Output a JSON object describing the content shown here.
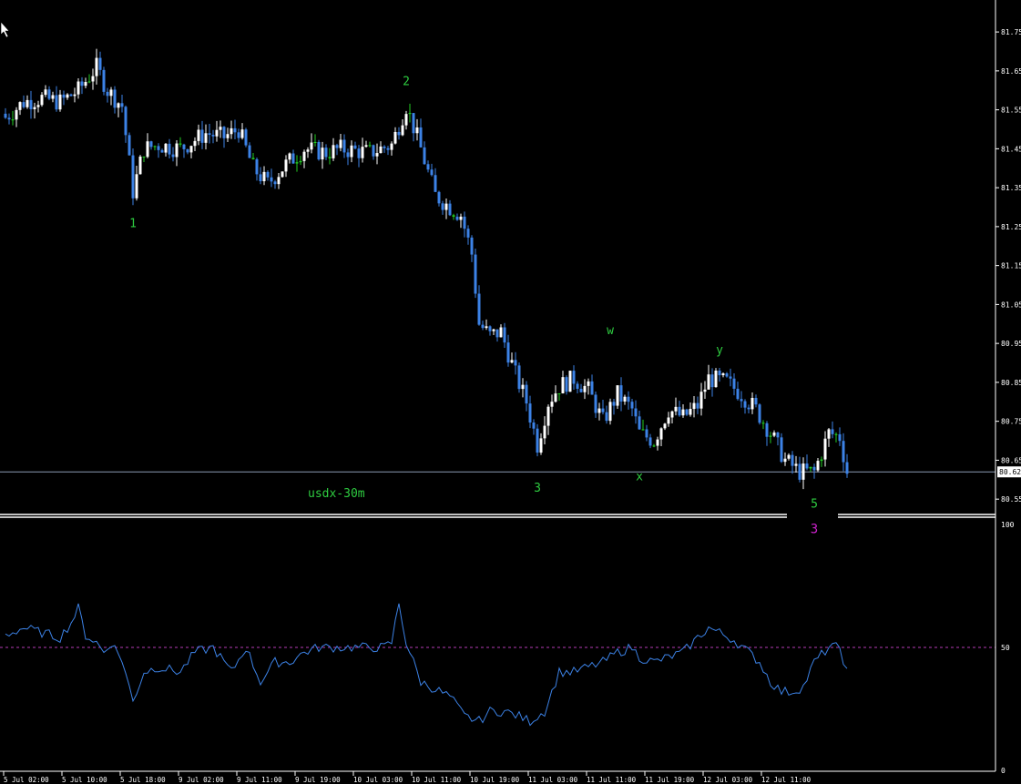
{
  "chart_data": [
    {
      "type": "candlestick",
      "title": "usdx-30m",
      "y_ticks": [
        "81.75",
        "81.65",
        "81.55",
        "81.45",
        "81.35",
        "81.25",
        "81.15",
        "81.05",
        "80.95",
        "80.85",
        "80.75",
        "80.65",
        "80.55"
      ],
      "ylim": [
        80.52,
        81.79
      ],
      "current_price": 80.62,
      "current_price_label": "80.62",
      "x_ticks": [
        "5 Jul 02:00",
        "5 Jul 10:00",
        "5 Jul 18:00",
        "9 Jul 02:00",
        "9 Jul 11:00",
        "9 Jul 19:00",
        "10 Jul 03:00",
        "10 Jul 11:00",
        "10 Jul 19:00",
        "11 Jul 03:00",
        "11 Jul 11:00",
        "11 Jul 19:00",
        "12 Jul 03:00",
        "12 Jul 11:00"
      ],
      "colors": {
        "bull": "#ffffff",
        "bear": "#3c82e6",
        "doji": "#22cc22",
        "price_line": "#8c9bb4",
        "labels": "#2ecc40",
        "magenta": "#cc22cc"
      },
      "wave_labels": [
        {
          "text": "1",
          "bar": 35,
          "price": 81.3,
          "place": "below"
        },
        {
          "text": "2",
          "bar": 110,
          "price": 81.59,
          "place": "above"
        },
        {
          "text": "3",
          "bar": 146,
          "price": 80.62,
          "place": "below"
        },
        {
          "text": "w",
          "bar": 166,
          "price": 80.95,
          "place": "above"
        },
        {
          "text": "x",
          "bar": 174,
          "price": 80.65,
          "place": "below"
        },
        {
          "text": "y",
          "bar": 196,
          "price": 80.9,
          "place": "above"
        },
        {
          "text": "5",
          "bar": 222,
          "price": 80.58,
          "place": "below"
        }
      ],
      "extra_label": {
        "text": "3",
        "color": "#cc22cc"
      },
      "anchors": [
        [
          0,
          81.53
        ],
        [
          5,
          81.57
        ],
        [
          10,
          81.58
        ],
        [
          15,
          81.57
        ],
        [
          20,
          81.6
        ],
        [
          25,
          81.66
        ],
        [
          28,
          81.6
        ],
        [
          32,
          81.56
        ],
        [
          35,
          81.34
        ],
        [
          38,
          81.45
        ],
        [
          42,
          81.46
        ],
        [
          48,
          81.45
        ],
        [
          55,
          81.49
        ],
        [
          60,
          81.48
        ],
        [
          64,
          81.5
        ],
        [
          68,
          81.4
        ],
        [
          72,
          81.36
        ],
        [
          77,
          81.41
        ],
        [
          82,
          81.45
        ],
        [
          88,
          81.44
        ],
        [
          92,
          81.45
        ],
        [
          100,
          81.44
        ],
        [
          106,
          81.46
        ],
        [
          110,
          81.56
        ],
        [
          113,
          81.48
        ],
        [
          118,
          81.33
        ],
        [
          122,
          81.3
        ],
        [
          125,
          81.28
        ],
        [
          128,
          81.18
        ],
        [
          130,
          81.0
        ],
        [
          133,
          80.97
        ],
        [
          136,
          80.98
        ],
        [
          140,
          80.87
        ],
        [
          143,
          80.8
        ],
        [
          146,
          80.69
        ],
        [
          149,
          80.8
        ],
        [
          152,
          80.84
        ],
        [
          156,
          80.86
        ],
        [
          160,
          80.83
        ],
        [
          164,
          80.75
        ],
        [
          168,
          80.82
        ],
        [
          172,
          80.78
        ],
        [
          174,
          80.72
        ],
        [
          178,
          80.7
        ],
        [
          182,
          80.78
        ],
        [
          186,
          80.76
        ],
        [
          190,
          80.79
        ],
        [
          193,
          80.86
        ],
        [
          198,
          80.85
        ],
        [
          202,
          80.82
        ],
        [
          206,
          80.78
        ],
        [
          210,
          80.72
        ],
        [
          214,
          80.65
        ],
        [
          218,
          80.62
        ],
        [
          222,
          80.62
        ],
        [
          226,
          80.72
        ],
        [
          229,
          80.71
        ],
        [
          231,
          80.62
        ]
      ]
    },
    {
      "type": "line",
      "name": "oscillator",
      "y_ticks": [
        "100",
        "50",
        "0"
      ],
      "ylim": [
        0,
        100
      ],
      "level": 50,
      "colors": {
        "line": "#3c82e6",
        "level": "#b43cb4"
      },
      "anchors": [
        [
          0,
          55
        ],
        [
          5,
          58
        ],
        [
          10,
          56
        ],
        [
          15,
          54
        ],
        [
          18,
          60
        ],
        [
          20,
          66
        ],
        [
          22,
          55
        ],
        [
          25,
          52
        ],
        [
          27,
          48
        ],
        [
          29,
          52
        ],
        [
          32,
          45
        ],
        [
          35,
          28
        ],
        [
          38,
          40
        ],
        [
          42,
          42
        ],
        [
          48,
          40
        ],
        [
          52,
          48
        ],
        [
          57,
          50
        ],
        [
          62,
          40
        ],
        [
          66,
          50
        ],
        [
          70,
          36
        ],
        [
          74,
          44
        ],
        [
          78,
          44
        ],
        [
          82,
          48
        ],
        [
          86,
          50
        ],
        [
          90,
          50
        ],
        [
          94,
          50
        ],
        [
          99,
          50
        ],
        [
          104,
          50
        ],
        [
          106,
          52
        ],
        [
          108,
          68
        ],
        [
          110,
          52
        ],
        [
          114,
          36
        ],
        [
          118,
          33
        ],
        [
          122,
          30
        ],
        [
          126,
          22
        ],
        [
          130,
          20
        ],
        [
          133,
          24
        ],
        [
          137,
          24
        ],
        [
          141,
          22
        ],
        [
          144,
          20
        ],
        [
          148,
          24
        ],
        [
          152,
          40
        ],
        [
          156,
          40
        ],
        [
          160,
          42
        ],
        [
          164,
          44
        ],
        [
          168,
          48
        ],
        [
          172,
          50
        ],
        [
          174,
          46
        ],
        [
          178,
          44
        ],
        [
          182,
          46
        ],
        [
          186,
          48
        ],
        [
          190,
          54
        ],
        [
          193,
          58
        ],
        [
          196,
          56
        ],
        [
          200,
          53
        ],
        [
          204,
          48
        ],
        [
          207,
          44
        ],
        [
          210,
          36
        ],
        [
          213,
          32
        ],
        [
          216,
          32
        ],
        [
          219,
          34
        ],
        [
          222,
          44
        ],
        [
          226,
          50
        ],
        [
          229,
          50
        ],
        [
          231,
          40
        ]
      ]
    }
  ]
}
